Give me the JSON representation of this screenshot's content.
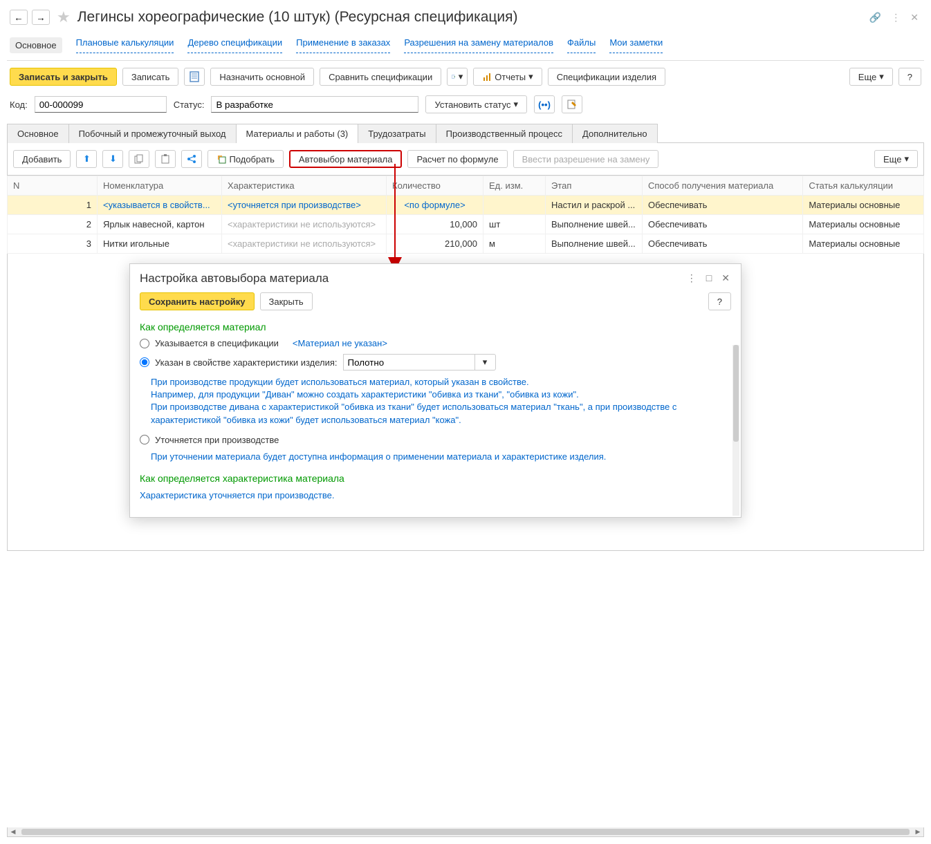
{
  "header": {
    "back": "←",
    "fwd": "→",
    "title": "Легинсы хореографические (10 штук) (Ресурсная спецификация)"
  },
  "nav": {
    "main": "Основное",
    "plan": "Плановые калькуляции",
    "tree": "Дерево спецификации",
    "orders": "Применение в заказах",
    "subst": "Разрешения на замену материалов",
    "files": "Файлы",
    "notes": "Мои заметки"
  },
  "toolbar": {
    "save_close": "Записать и закрыть",
    "save": "Записать",
    "set_main": "Назначить основной",
    "compare": "Сравнить спецификации",
    "reports": "Отчеты",
    "product_specs": "Спецификации изделия",
    "more": "Еще",
    "help": "?"
  },
  "fields": {
    "code_label": "Код:",
    "code_value": "00-000099",
    "status_label": "Статус:",
    "status_value": "В разработке",
    "set_status": "Установить статус"
  },
  "tabs": {
    "main": "Основное",
    "side": "Побочный и промежуточный выход",
    "materials": "Материалы и работы (3)",
    "labor": "Трудозатраты",
    "process": "Производственный процесс",
    "extra": "Дополнительно"
  },
  "subtb": {
    "add": "Добавить",
    "pick": "Подобрать",
    "autoselect": "Автовыбор материала",
    "formula": "Расчет по формуле",
    "subst": "Ввести разрешение на замену",
    "more": "Еще"
  },
  "cols": {
    "n": "N",
    "nomen": "Номенклатура",
    "char": "Характеристика",
    "qty": "Количество",
    "unit": "Ед. изм.",
    "stage": "Этап",
    "method": "Способ получения материала",
    "calc": "Статья калькуляции"
  },
  "rows": [
    {
      "n": "1",
      "nomen": "<указывается в свойств...",
      "char": "<уточняется при производстве>",
      "qty": "<по формуле>",
      "unit": "",
      "stage": "Настил и раскрой ...",
      "method": "Обеспечивать",
      "calc": "Материалы основные"
    },
    {
      "n": "2",
      "nomen": "Ярлык навесной, картон",
      "char": "<характеристики не используются>",
      "qty": "10,000",
      "unit": "шт",
      "stage": "Выполнение швей...",
      "method": "Обеспечивать",
      "calc": "Материалы основные"
    },
    {
      "n": "3",
      "nomen": "Нитки игольные",
      "char": "<характеристики не используются>",
      "qty": "210,000",
      "unit": "м",
      "stage": "Выполнение швей...",
      "method": "Обеспечивать",
      "calc": "Материалы основные"
    }
  ],
  "popup": {
    "title": "Настройка автовыбора материала",
    "save": "Сохранить настройку",
    "close": "Закрыть",
    "help": "?",
    "section1": "Как определяется материал",
    "opt1": "Указывается в спецификации",
    "opt1_link": "<Материал не указан>",
    "opt2": "Указан в свойстве характеристики изделия:",
    "opt2_value": "Полотно",
    "info1": "При производстве продукции будет использоваться материал, который указан в свойстве.\nНапример, для продукции \"Диван\" можно создать характеристики \"обивка из ткани\", \"обивка из кожи\".\nПри производстве дивана с характеристикой \"обивка из ткани\" будет использоваться материал \"ткань\", а при производстве с характеристикой \"обивка из кожи\" будет использоваться материал \"кожа\".",
    "opt3": "Уточняется при производстве",
    "info2": "При уточнении материала будет доступна информация о применении материала и характеристике изделия.",
    "section2": "Как определяется характеристика материала",
    "info3": "Характеристика уточняется при производстве."
  }
}
